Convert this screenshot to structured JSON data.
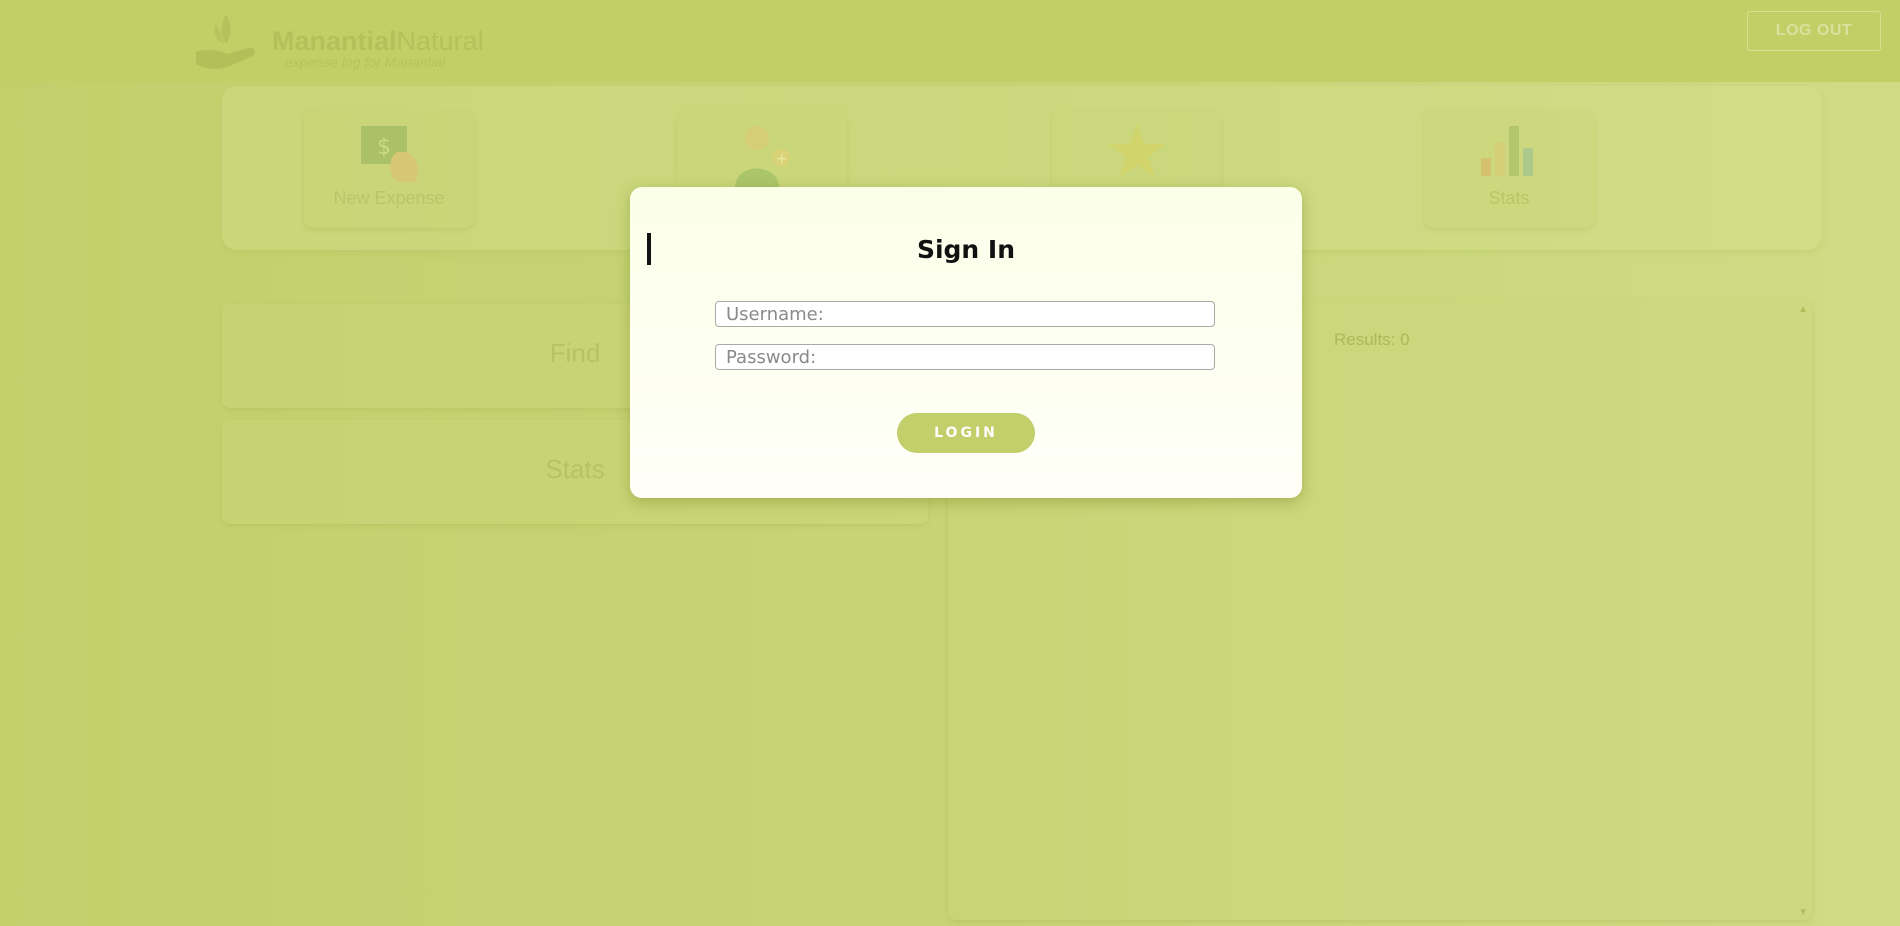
{
  "header": {
    "brand_bold": "Manantial",
    "brand_light": "Natural",
    "tagline": "expense log for Manantial",
    "logout_label": "LOG OUT"
  },
  "menu": {
    "items": [
      {
        "label": "New Expense",
        "icon": "money-bag-icon"
      },
      {
        "label": "",
        "icon": "person-add-icon"
      },
      {
        "label": "",
        "icon": "star-icon"
      },
      {
        "label": "Stats",
        "icon": "bar-chart-icon"
      }
    ]
  },
  "sections": {
    "find_title": "Find",
    "stats_title": "Stats"
  },
  "results": {
    "count_text": "Results: 0"
  },
  "modal": {
    "title": "Sign In",
    "username_placeholder": "Username:",
    "password_placeholder": "Password:",
    "login_label": "LOGIN"
  },
  "colors": {
    "background": "#c3d06d",
    "accent": "#c2cf6a",
    "modal_bg": "#fdfff0"
  }
}
